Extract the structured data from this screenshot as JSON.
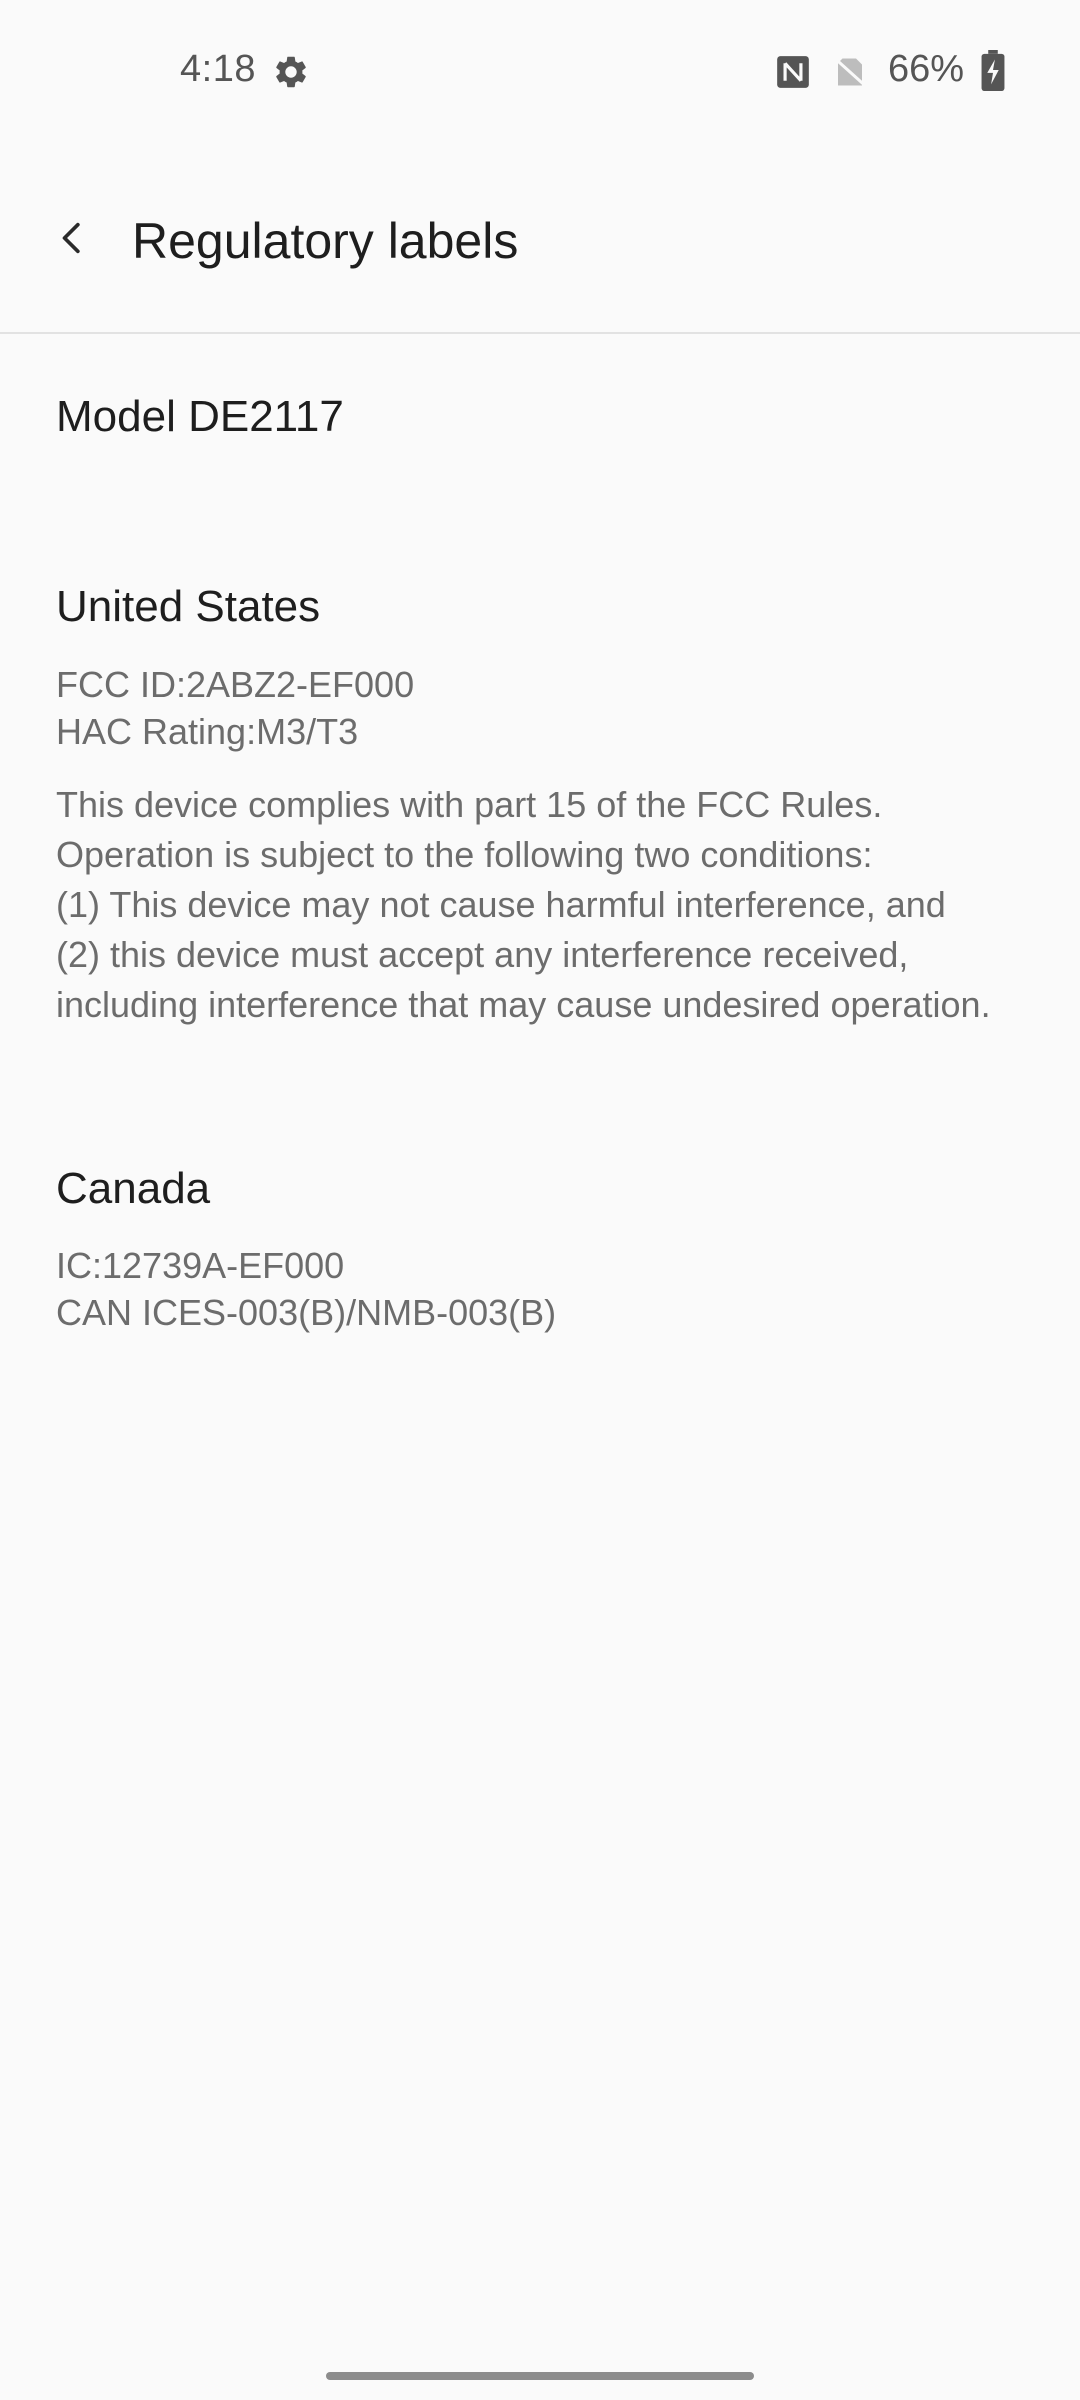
{
  "status_bar": {
    "time": "4:18",
    "battery": "66%",
    "icons": [
      "settings-gear-icon",
      "nfc-icon",
      "no-sim-icon",
      "battery-charging-icon"
    ]
  },
  "app_bar": {
    "title": "Regulatory labels",
    "back_icon": "back-arrow-icon"
  },
  "model": "Model DE2117",
  "sections": {
    "us": {
      "title": "United States",
      "lines": [
        "FCC ID:2ABZ2-EF000",
        "HAC Rating:M3/T3"
      ],
      "paragraph": [
        "This device complies with part 15 of the FCC Rules.",
        "Operation is subject to the following two conditions:",
        "(1) This device may not cause harmful interference, and",
        "(2) this device must accept any interference received,",
        "including interference that may cause undesired operation."
      ]
    },
    "canada": {
      "title": "Canada",
      "lines": [
        "IC:12739A-EF000",
        "CAN ICES-003(B)/NMB-003(B)"
      ]
    }
  },
  "colors": {
    "background": "#fafafa",
    "primary_text": "#1e1e1e",
    "secondary_text": "#6c6c6c",
    "divider": "#e2e2e2"
  }
}
